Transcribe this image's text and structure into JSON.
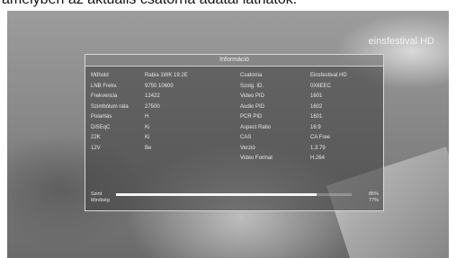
{
  "caption": "amelyben az aktuális csatorna adatai láthatók.",
  "channel_logo": "einsfestival HD",
  "panel": {
    "title": "Információ",
    "left_rows": [
      {
        "label": "Műhold",
        "value": "Rabia 1WK 19.2E"
      },
      {
        "label": "LNB Frekv.",
        "value": "9750 10600"
      },
      {
        "label": "Frekvencia",
        "value": "12422"
      },
      {
        "label": "Szimbólum ráta",
        "value": "27500"
      },
      {
        "label": "Polaritás",
        "value": "H"
      },
      {
        "label": "DiSEqC",
        "value": "Ki"
      },
      {
        "label": "22K",
        "value": "Ki"
      },
      {
        "label": "12V",
        "value": "Be"
      }
    ],
    "right_rows": [
      {
        "label": "Csatorna",
        "value": "Einsfestival HD"
      },
      {
        "label": "Szolg. ID.",
        "value": "0X6EEC"
      },
      {
        "label": "Video PID",
        "value": "1601"
      },
      {
        "label": "Audio PID",
        "value": "1602"
      },
      {
        "label": "PCR PID",
        "value": "1601"
      },
      {
        "label": "Aspect Ratio",
        "value": "16:9"
      },
      {
        "label": "CAS",
        "value": "CA Free"
      },
      {
        "label": "Verzió",
        "value": "1.3.79"
      },
      {
        "label": "Video Format",
        "value": "H.264"
      }
    ],
    "signal": {
      "strength_label": "Szint",
      "strength_value": "85%",
      "strength_fraction": 0.85,
      "quality_label": "Minőség",
      "quality_value": "77%",
      "quality_fraction": 0.77
    }
  }
}
